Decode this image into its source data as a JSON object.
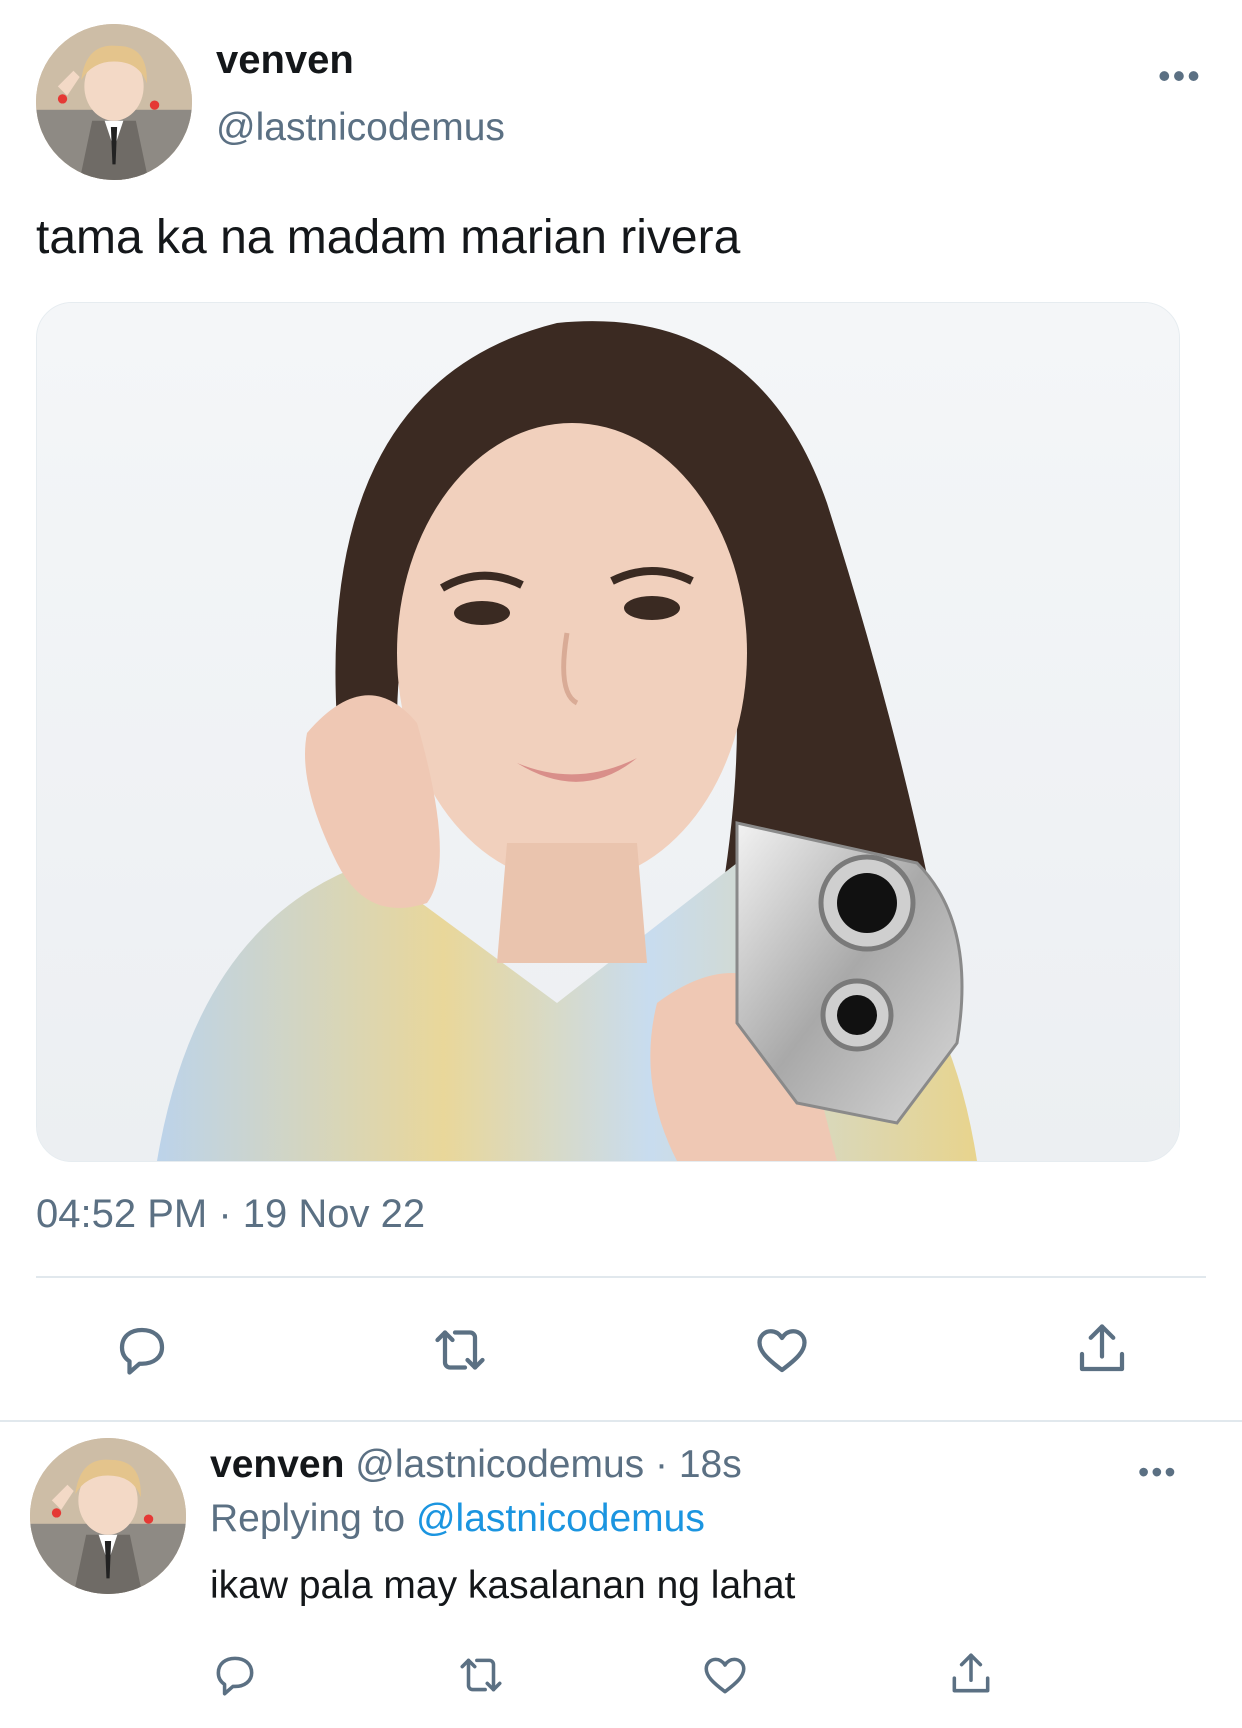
{
  "tweet": {
    "author_name": "venven",
    "author_handle": "@lastnicodemus",
    "text": "tama ka na madam marian rivera",
    "time": "04:52 PM",
    "separator": "·",
    "date": "19 Nov 22",
    "more_label": "•••"
  },
  "actions": [
    "reply-icon",
    "retweet-icon",
    "like-icon",
    "share-icon"
  ],
  "reply": {
    "author_name": "venven",
    "author_handle": "@lastnicodemus",
    "separator": "·",
    "age": "18s",
    "replying_prefix": "Replying to",
    "replying_handle": "@lastnicodemus",
    "text": "ikaw pala may kasalanan ng lahat",
    "more_label": "•••"
  },
  "colors": {
    "text": "#14171a",
    "secondary": "#5b7083",
    "link": "#1b95e0",
    "divider": "#e1e8ed"
  }
}
